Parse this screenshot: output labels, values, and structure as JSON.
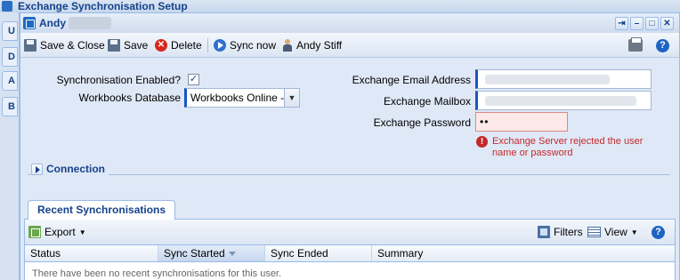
{
  "background_window": {
    "title": "Exchange Synchronisation Setup",
    "side_tabs": [
      "U",
      "D",
      "A",
      "B"
    ]
  },
  "window": {
    "title_prefix": "Andy",
    "tools": [
      "pin",
      "minimize",
      "maximize",
      "close"
    ]
  },
  "toolbar": {
    "save_close_label": "Save & Close",
    "save_label": "Save",
    "delete_label": "Delete",
    "sync_label": "Sync now",
    "user_label": "Andy Stiff"
  },
  "form": {
    "sync_enabled_label": "Synchronisation Enabled?",
    "sync_enabled_checked": true,
    "check_mark": "✓",
    "database_label": "Workbooks Database",
    "database_value": "Workbooks Online - N",
    "email_label": "Exchange Email Address",
    "mailbox_label": "Exchange Mailbox",
    "password_label": "Exchange Password",
    "password_value": "••",
    "error_message": "Exchange Server rejected the user name or password"
  },
  "connection": {
    "title": "Connection",
    "collapsed": true
  },
  "tabs": {
    "recent_label": "Recent Synchronisations"
  },
  "grid": {
    "export_label": "Export",
    "filters_label": "Filters",
    "view_label": "View",
    "columns": [
      "Status",
      "Sync Started",
      "Sync Ended",
      "Summary"
    ],
    "sorted_column": "Sync Started",
    "empty_text": "There have been no recent synchronisations for this user."
  },
  "colors": {
    "accent": "#15428b",
    "error": "#c42a2a",
    "required_marker": "#1c55c4"
  }
}
